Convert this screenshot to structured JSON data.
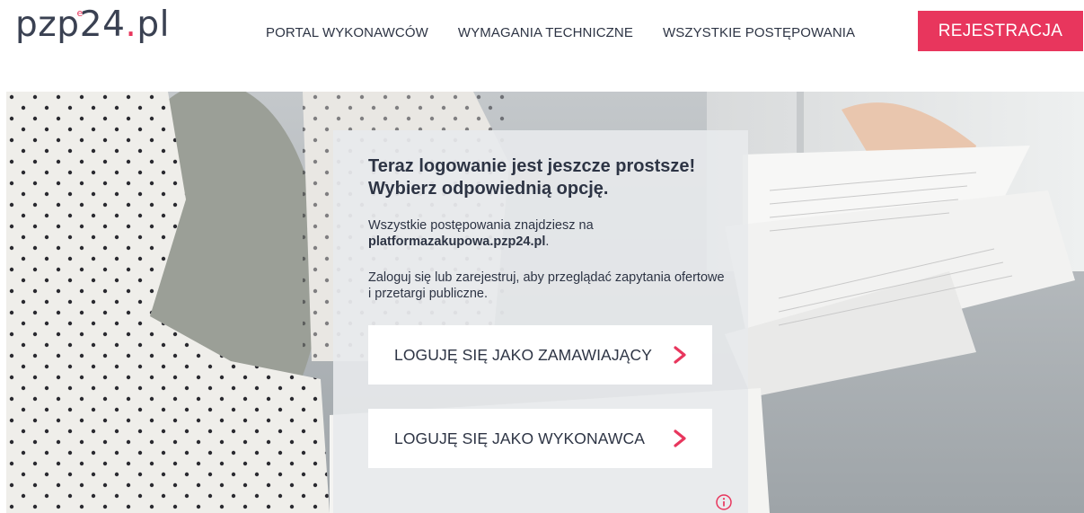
{
  "header": {
    "logo": {
      "part1": "pzp",
      "sup": "e",
      "part2": "24",
      "dot": ".",
      "part3": "pl"
    },
    "nav": [
      {
        "label": "PORTAL WYKONAWCÓW"
      },
      {
        "label": "WYMAGANIA TECHNICZNE"
      },
      {
        "label": "WSZYSTKIE POSTĘPOWANIA"
      }
    ],
    "register_label": "REJESTRACJA"
  },
  "panel": {
    "title": "Teraz logowanie jest jeszcze prostsze! Wybierz odpowiednią opcję.",
    "text1_prefix": "Wszystkie postępowania znajdziesz na ",
    "text1_link": "platformazakupowa.pzp24.pl",
    "text1_suffix": ".",
    "text2": "Zaloguj się lub zarejestruj, aby przeglądać zapytania ofertowe i przetargi publiczne.",
    "buttons": [
      {
        "label": "LOGUJĘ SIĘ JAKO ZAMAWIAJĄCY",
        "icon": "chevron-right-icon"
      },
      {
        "label": "LOGUJĘ SIĘ JAKO WYKONAWCA",
        "icon": "chevron-right-icon"
      }
    ]
  },
  "icons": {
    "info": "info-icon"
  },
  "colors": {
    "accent": "#e8365d",
    "text": "#2d3444",
    "logo": "#3a4152"
  }
}
